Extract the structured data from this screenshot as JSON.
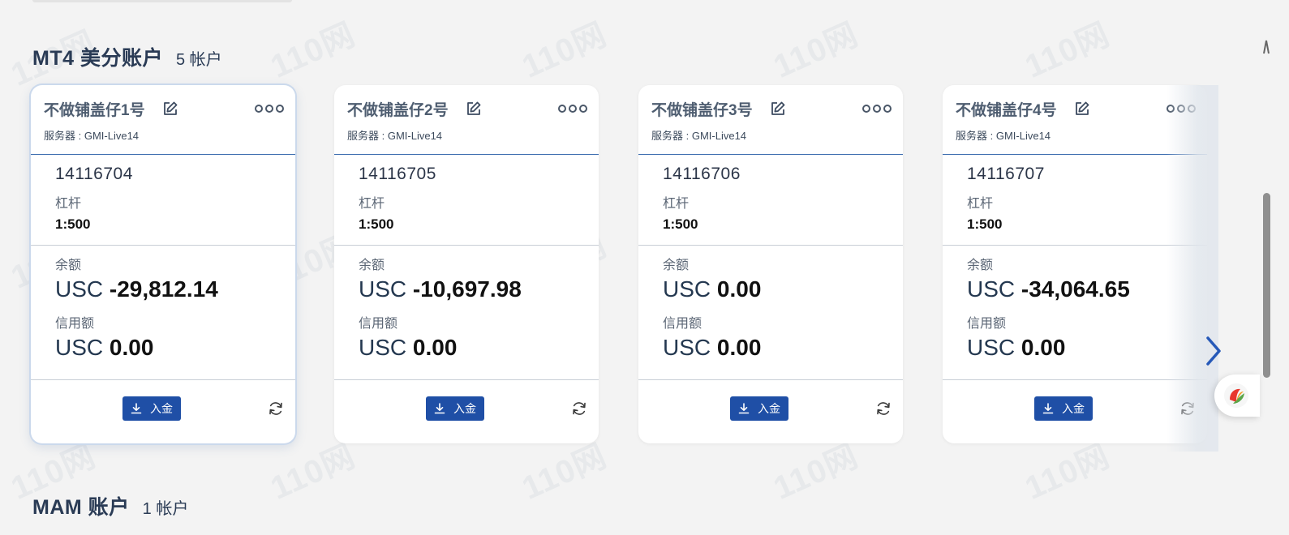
{
  "sections": {
    "mt4": {
      "title": "MT4 美分账户",
      "count": "5 帐户"
    },
    "mam": {
      "title": "MAM 账户",
      "count": "1 帐户"
    }
  },
  "labels": {
    "leverage": "杠杆",
    "balance": "余额",
    "credit": "信用额",
    "deposit": "入金"
  },
  "accounts": [
    {
      "name": "不做铺盖仔1号",
      "server": "服务器 : GMI-Live14",
      "number": "14116704",
      "leverage": "1:500",
      "balance_currency": "USC",
      "balance": "-29,812.14",
      "credit_currency": "USC",
      "credit": "0.00"
    },
    {
      "name": "不做铺盖仔2号",
      "server": "服务器 : GMI-Live14",
      "number": "14116705",
      "leverage": "1:500",
      "balance_currency": "USC",
      "balance": "-10,697.98",
      "credit_currency": "USC",
      "credit": "0.00"
    },
    {
      "name": "不做铺盖仔3号",
      "server": "服务器 : GMI-Live14",
      "number": "14116706",
      "leverage": "1:500",
      "balance_currency": "USC",
      "balance": "0.00",
      "credit_currency": "USC",
      "credit": "0.00"
    },
    {
      "name": "不做铺盖仔4号",
      "server": "服务器 : GMI-Live14",
      "number": "14116707",
      "leverage": "1:500",
      "balance_currency": "USC",
      "balance": "-34,064.65",
      "credit_currency": "USC",
      "credit": "0.00"
    }
  ],
  "watermark": "110网",
  "colors": {
    "accent": "#1f4fa6",
    "card_divider": "#3f6fb0",
    "page_bg": "#f3f3f3"
  },
  "icons": {
    "edit": "edit-icon",
    "more": "more-icon",
    "download": "download-icon",
    "refresh": "refresh-icon",
    "next": "chevron-right-icon"
  }
}
